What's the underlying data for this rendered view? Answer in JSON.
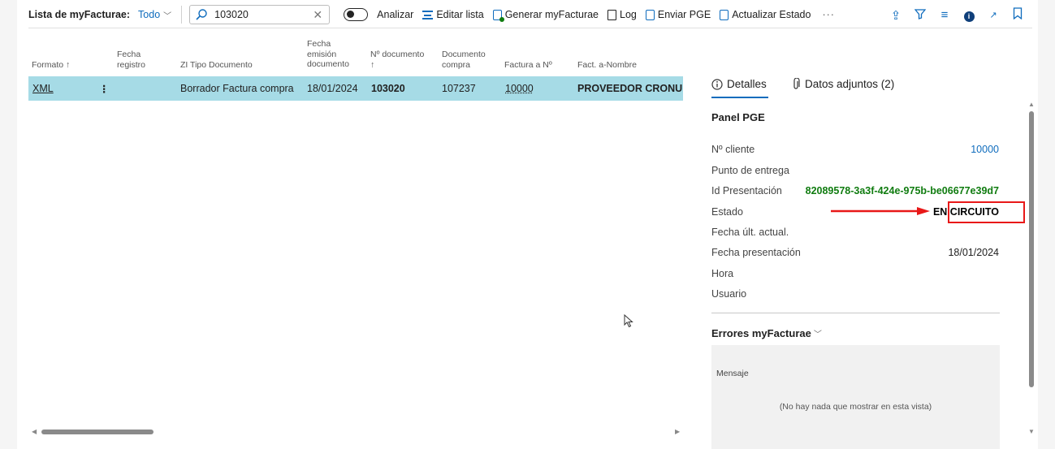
{
  "toolbar": {
    "title": "Lista de myFacturae:",
    "filter_label": "Todo",
    "search_value": "103020",
    "analyze_label": "Analizar",
    "edit_list_label": "Editar lista",
    "generate_label": "Generar myFacturae",
    "log_label": "Log",
    "send_label": "Enviar PGE",
    "update_label": "Actualizar Estado",
    "more_label": "···"
  },
  "table": {
    "headers": {
      "formato": "Formato ↑",
      "fecha_registro_1": "Fecha",
      "fecha_registro_2": "registro",
      "tipo_documento": "ZI Tipo Documento",
      "fecha_emision_1": "Fecha",
      "fecha_emision_2": "emisión",
      "fecha_emision_3": "documento",
      "n_documento_1": "Nº documento",
      "n_documento_2": "↑",
      "documento_compra_1": "Documento",
      "documento_compra_2": "compra",
      "factura_a": "Factura a Nº",
      "fact_nombre": "Fact. a-Nombre"
    },
    "row": {
      "formato": "XML",
      "menu": "⋮",
      "tipo_documento": "Borrador Factura compra",
      "fecha_emision": "18/01/2024",
      "n_documento": "103020",
      "documento_compra": "107237",
      "factura_a": "10000",
      "fact_nombre": "PROVEEDOR CRONU..."
    }
  },
  "panel": {
    "tab_details": "Detalles",
    "tab_attachments": "Datos adjuntos (2)",
    "section_title": "Panel PGE",
    "fields": {
      "cliente_label": "Nº cliente",
      "cliente_value": "10000",
      "punto_label": "Punto de entrega",
      "id_label": "Id Presentación",
      "id_value": "82089578-3a3f-424e-975b-be06677e39d7",
      "estado_label": "Estado",
      "estado_value": "EN CIRCUITO",
      "fecha_act_label": "Fecha últ. actual.",
      "fecha_pres_label": "Fecha presentación",
      "fecha_pres_value": "18/01/2024",
      "hora_label": "Hora",
      "usuario_label": "Usuario"
    },
    "errors_title": "Errores myFacturae",
    "errors_col": "Mensaje",
    "errors_empty": "(No hay nada que mostrar en esta vista)"
  },
  "colors": {
    "accent": "#0f6cbd",
    "selected_row": "#a6dbe6",
    "highlight": "#e81818",
    "id_green": "#107c10"
  }
}
